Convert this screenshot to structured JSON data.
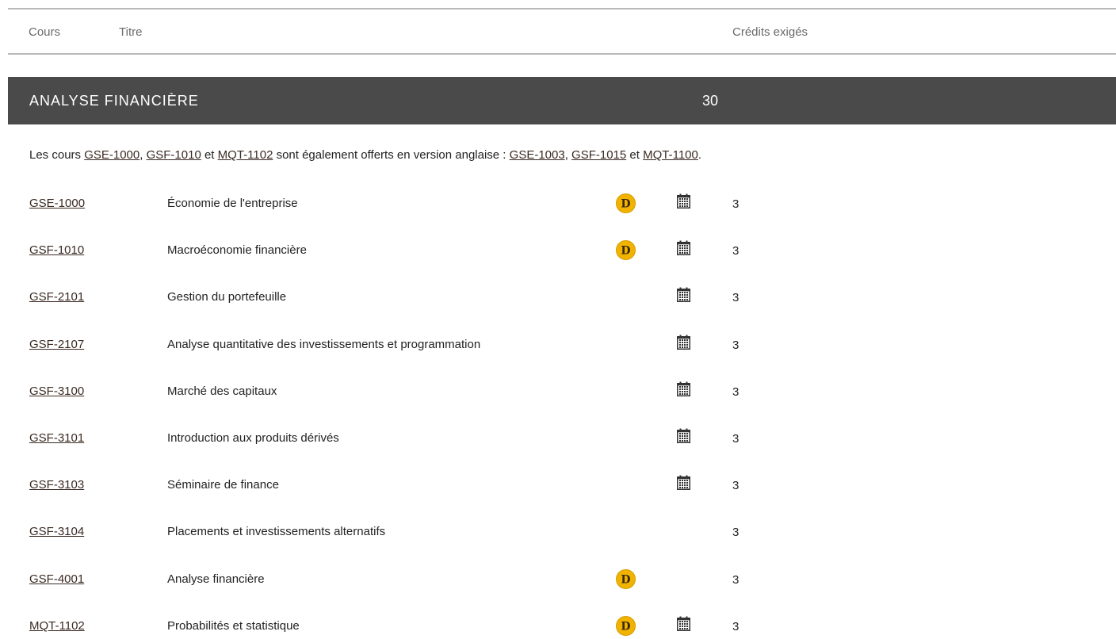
{
  "table_header": {
    "course": "Cours",
    "title": "Titre",
    "credits": "Crédits exigés"
  },
  "section": {
    "name": "ANALYSE FINANCIÈRE",
    "credits": "30"
  },
  "note": {
    "prefix": "Les cours ",
    "link1": "GSE-1000",
    "sep1": ", ",
    "link2": "GSF-1010",
    "sep2": " et ",
    "link3": "MQT-1102",
    "middle": " sont également offerts en version anglaise : ",
    "link4": "GSE-1003",
    "sep3": ", ",
    "link5": "GSF-1015",
    "sep4": " et ",
    "link6": "MQT-1100",
    "suffix": "."
  },
  "icons": {
    "distance_letter": "D",
    "distance_color": "#f0b400",
    "calendar_color": "#333333"
  },
  "courses": [
    {
      "code": "GSE-1000",
      "title": "Économie de l'entreprise",
      "distance": true,
      "calendar": true,
      "credits": "3"
    },
    {
      "code": "GSF-1010",
      "title": "Macroéconomie financière",
      "distance": true,
      "calendar": true,
      "credits": "3"
    },
    {
      "code": "GSF-2101",
      "title": "Gestion du portefeuille",
      "distance": false,
      "calendar": true,
      "credits": "3"
    },
    {
      "code": "GSF-2107",
      "title": "Analyse quantitative des investissements et programmation",
      "distance": false,
      "calendar": true,
      "credits": "3"
    },
    {
      "code": "GSF-3100",
      "title": "Marché des capitaux",
      "distance": false,
      "calendar": true,
      "credits": "3"
    },
    {
      "code": "GSF-3101",
      "title": "Introduction aux produits dérivés",
      "distance": false,
      "calendar": true,
      "credits": "3"
    },
    {
      "code": "GSF-3103",
      "title": "Séminaire de finance",
      "distance": false,
      "calendar": true,
      "credits": "3"
    },
    {
      "code": "GSF-3104",
      "title": "Placements et investissements alternatifs",
      "distance": false,
      "calendar": false,
      "credits": "3"
    },
    {
      "code": "GSF-4001",
      "title": "Analyse financière",
      "distance": true,
      "calendar": false,
      "credits": "3"
    },
    {
      "code": "MQT-1102",
      "title": "Probabilités et statistique",
      "distance": true,
      "calendar": true,
      "credits": "3"
    }
  ]
}
